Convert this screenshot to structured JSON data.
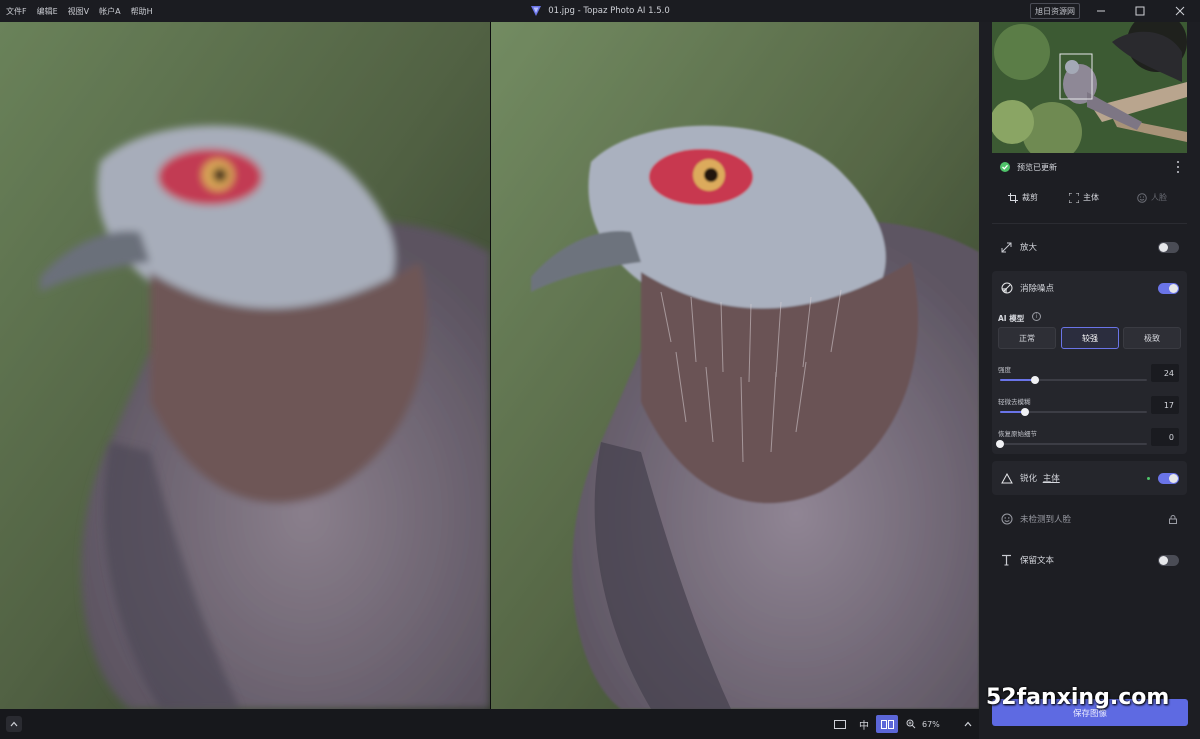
{
  "menu": [
    "文件F",
    "编辑E",
    "视图V",
    "帐户A",
    "帮助H"
  ],
  "window": {
    "title": "01.jpg - Topaz Photo AI 1.5.0",
    "site_badge": "旭日资源网",
    "minimize_icon": "minimize-icon",
    "maximize_icon": "maximize-icon",
    "close_icon": "close-icon"
  },
  "panel": {
    "preview_status": "预览已更新",
    "tools": {
      "crop": "裁剪",
      "subject": "主体",
      "face": "人脸"
    },
    "upscale": {
      "label": "放大",
      "enabled": false
    },
    "denoise": {
      "label": "消除噪点",
      "enabled": true,
      "ai_model_label": "AI 模型",
      "modes": [
        "正常",
        "较强",
        "极致"
      ],
      "active_mode": "较强",
      "sliders": [
        {
          "label": "强度",
          "value": "24",
          "fraction": 0.24
        },
        {
          "label": "轻微去模糊",
          "value": "17",
          "fraction": 0.17
        },
        {
          "label": "恢复原始细节",
          "value": "0",
          "fraction": 0.0
        }
      ]
    },
    "sharpen": {
      "label": "锐化",
      "target": "主体",
      "enabled": true
    },
    "face_recovery": {
      "label": "未检测到人脸",
      "locked": true
    },
    "preserve_text": {
      "label": "保留文本",
      "enabled": false
    },
    "save_button": "保存图像"
  },
  "bottom": {
    "view_center_label": "中",
    "active_view": "side-by-side",
    "zoom": "67%"
  },
  "watermark": "52fanxing.com",
  "colors": {
    "accent": "#5e6ae2",
    "toggle_on": "#6a74e8",
    "status_ok": "#4fc36a",
    "panel_bg": "#1d1e23"
  }
}
